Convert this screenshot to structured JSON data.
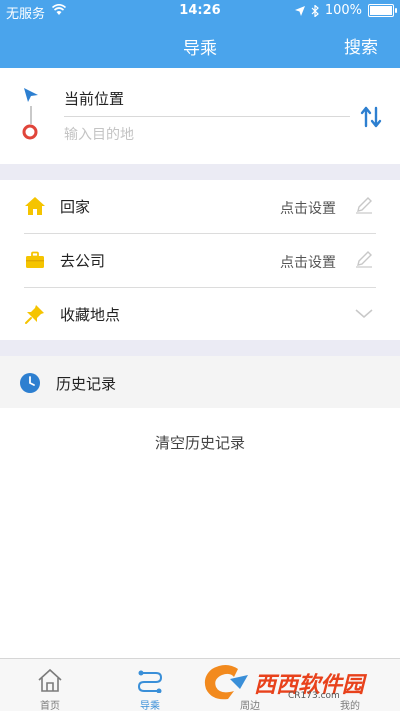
{
  "status_bar": {
    "carrier": "无服务",
    "time": "14:26",
    "battery": "100%"
  },
  "nav": {
    "title": "导乘",
    "search": "搜索"
  },
  "route": {
    "current_location": "当前位置",
    "destination_placeholder": "输入目的地"
  },
  "places": {
    "home_label": "回家",
    "home_action": "点击设置",
    "work_label": "去公司",
    "work_action": "点击设置",
    "favorites_label": "收藏地点"
  },
  "history": {
    "title": "历史记录",
    "clear": "清空历史记录"
  },
  "tabs": [
    {
      "label": "首页"
    },
    {
      "label": "导乘"
    },
    {
      "label": "周边"
    },
    {
      "label": "我的"
    }
  ],
  "watermark": {
    "text": "西西软件园",
    "url": "CR173.com"
  },
  "colors": {
    "accent": "#4aa4ec",
    "active_tab": "#3a8fd8",
    "home_icon": "#f5c400",
    "work_icon": "#f5c400",
    "destination_marker": "#e0453a"
  }
}
